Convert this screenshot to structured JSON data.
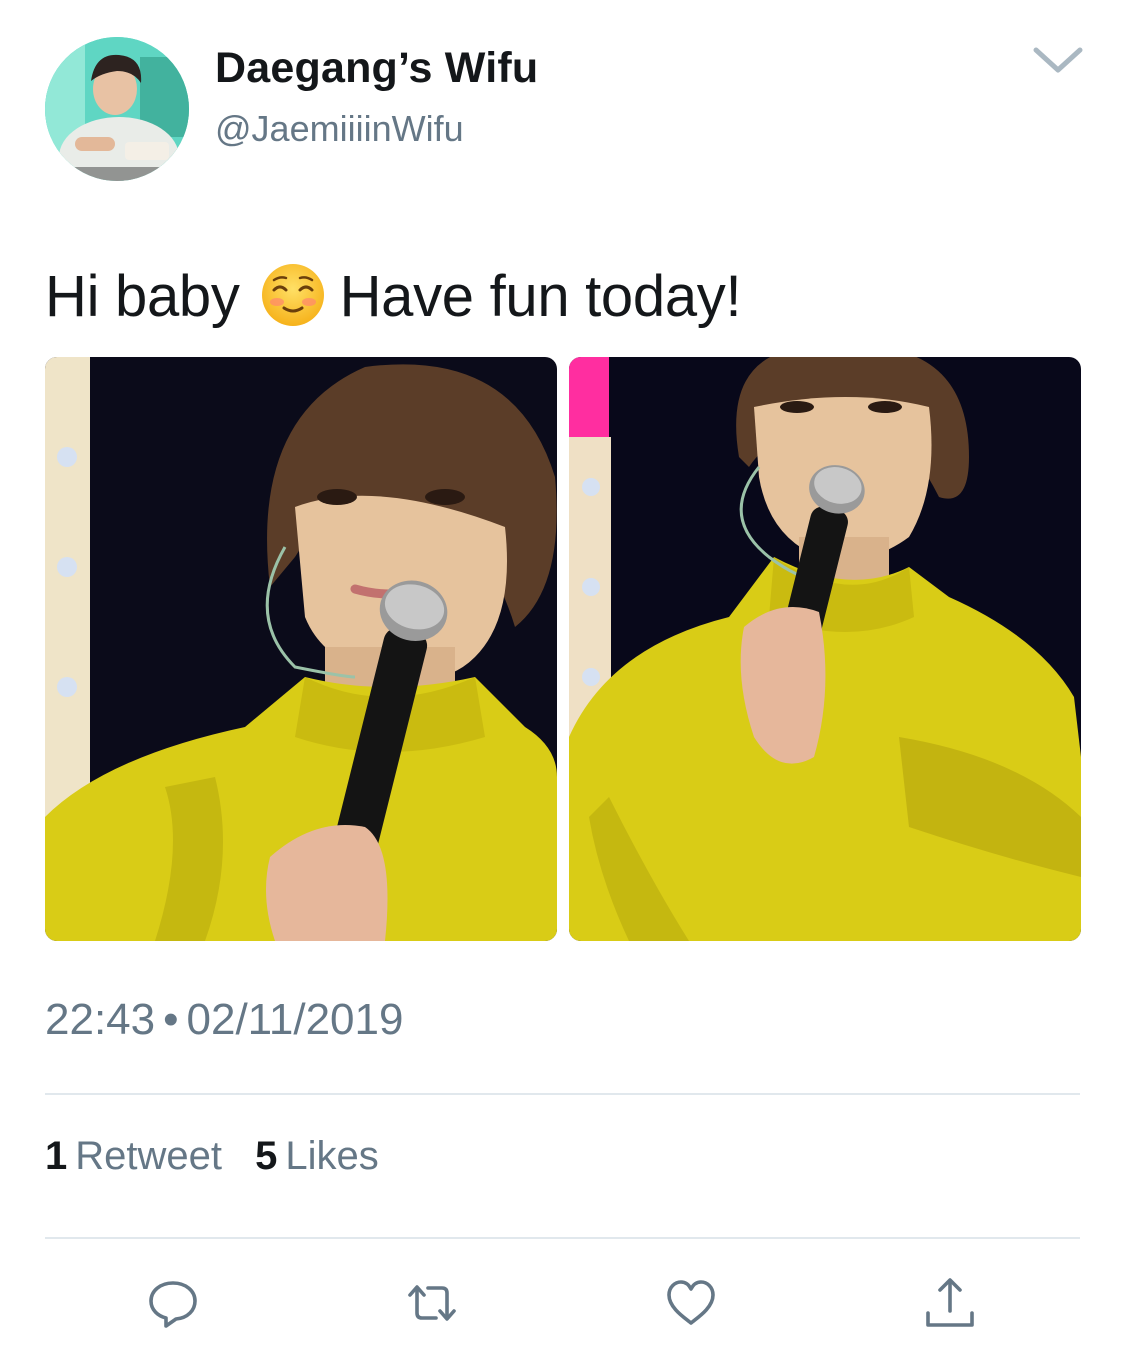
{
  "author": {
    "display_name": "Daegang’s Wifu",
    "handle": "@JaemiiiinWifu",
    "avatar_icon": "profile-photo"
  },
  "tweet": {
    "text_before_emoji": "Hi baby",
    "emoji": "smiling-face-with-smiling-eyes",
    "text_after_emoji": "Have fun today!",
    "media": [
      {
        "alt": "performer-in-yellow-turtleneck-holding-microphone"
      },
      {
        "alt": "performer-in-yellow-turtleneck-holding-microphone"
      }
    ]
  },
  "meta": {
    "time": "22:43",
    "separator": "•",
    "date": "02/11/2019"
  },
  "stats": {
    "retweet_count": "1",
    "retweet_label": "Retweet",
    "like_count": "5",
    "like_label": "Likes"
  },
  "actions": {
    "icons": [
      "reply-icon",
      "retweet-icon",
      "like-icon",
      "share-icon"
    ]
  },
  "colors": {
    "primary_text": "#14171a",
    "secondary_text": "#657786",
    "divider": "#e1e8ed",
    "sweater_yellow": "#d9cc16"
  }
}
